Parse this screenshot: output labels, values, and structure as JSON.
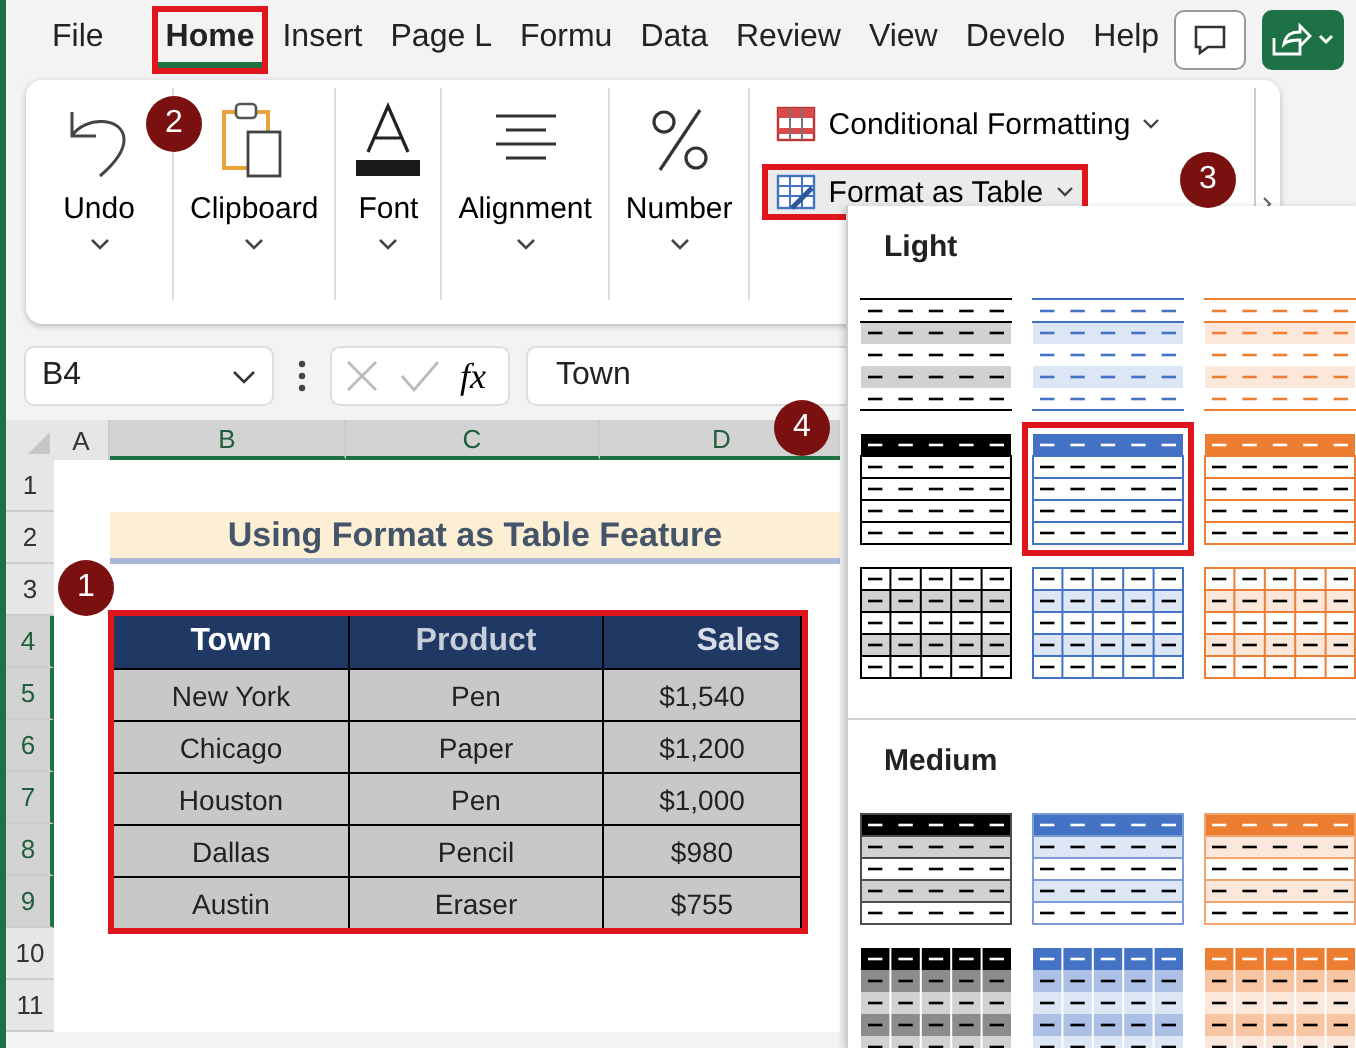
{
  "ribbon_tabs": [
    {
      "label": "File",
      "selected": false,
      "highlighted": false
    },
    {
      "label": "Home",
      "selected": true,
      "highlighted": true
    },
    {
      "label": "Insert",
      "selected": false,
      "highlighted": false
    },
    {
      "label": "Page L",
      "selected": false,
      "highlighted": false
    },
    {
      "label": "Formu",
      "selected": false,
      "highlighted": false
    },
    {
      "label": "Data",
      "selected": false,
      "highlighted": false
    },
    {
      "label": "Review",
      "selected": false,
      "highlighted": false
    },
    {
      "label": "View",
      "selected": false,
      "highlighted": false
    },
    {
      "label": "Develo",
      "selected": false,
      "highlighted": false
    },
    {
      "label": "Help",
      "selected": false,
      "highlighted": false
    }
  ],
  "ribbon_groups": [
    {
      "label": "Undo",
      "kind": "undo"
    },
    {
      "label": "Clipboard",
      "kind": "clipboard"
    },
    {
      "label": "Font",
      "kind": "font"
    },
    {
      "label": "Alignment",
      "kind": "alignment"
    },
    {
      "label": "Number",
      "kind": "number"
    }
  ],
  "styles_buttons": [
    {
      "label": "Conditional Formatting",
      "kind": "conditional",
      "highlighted": false
    },
    {
      "label": "Format as Table",
      "kind": "table",
      "highlighted": true
    }
  ],
  "formula_bar": {
    "name_box": "B4",
    "function_label": "fx",
    "value": "Town"
  },
  "sheet": {
    "columns": [
      {
        "label": "A",
        "selected": false
      },
      {
        "label": "B",
        "selected": true
      },
      {
        "label": "C",
        "selected": true
      },
      {
        "label": "D",
        "selected": true
      }
    ],
    "rows": [
      {
        "label": "1",
        "selected": false
      },
      {
        "label": "2",
        "selected": false
      },
      {
        "label": "3",
        "selected": false
      },
      {
        "label": "4",
        "selected": true
      },
      {
        "label": "5",
        "selected": true
      },
      {
        "label": "6",
        "selected": true
      },
      {
        "label": "7",
        "selected": true
      },
      {
        "label": "8",
        "selected": true
      },
      {
        "label": "9",
        "selected": true
      },
      {
        "label": "10",
        "selected": false
      },
      {
        "label": "11",
        "selected": false
      }
    ],
    "title": "Using Format as Table Feature",
    "table": {
      "highlighted": true,
      "columns": [
        "Town",
        "Product",
        "Sales"
      ],
      "rows": [
        [
          "New York",
          "Pen",
          "$1,540"
        ],
        [
          "Chicago",
          "Paper",
          "$1,200"
        ],
        [
          "Houston",
          "Pen",
          "$1,000"
        ],
        [
          "Dallas",
          "Pencil",
          "$980"
        ],
        [
          "Austin",
          "Eraser",
          "$755"
        ]
      ]
    }
  },
  "gallery": {
    "sections": [
      {
        "title": "Light",
        "styles": [
          {
            "kind": "banded",
            "color": "#000000",
            "selected": false
          },
          {
            "kind": "banded",
            "color": "#4472c4",
            "selected": false
          },
          {
            "kind": "banded",
            "color": "#ed7d31",
            "selected": false
          },
          {
            "kind": "header",
            "color": "#000000",
            "selected": false
          },
          {
            "kind": "header",
            "color": "#4472c4",
            "selected": true
          },
          {
            "kind": "header",
            "color": "#ed7d31",
            "selected": false
          },
          {
            "kind": "grid",
            "color": "#000000",
            "selected": false
          },
          {
            "kind": "grid",
            "color": "#4472c4",
            "selected": false
          },
          {
            "kind": "grid",
            "color": "#ed7d31",
            "selected": false
          }
        ]
      },
      {
        "title": "Medium",
        "styles": [
          {
            "kind": "medium",
            "color": "#000000",
            "selected": false
          },
          {
            "kind": "medium",
            "color": "#4472c4",
            "selected": false
          },
          {
            "kind": "medium",
            "color": "#ed7d31",
            "selected": false
          },
          {
            "kind": "medium-grid",
            "color": "#000000",
            "selected": false
          },
          {
            "kind": "medium-grid",
            "color": "#4472c4",
            "selected": false
          },
          {
            "kind": "medium-grid",
            "color": "#ed7d31",
            "selected": false
          }
        ]
      }
    ]
  },
  "callouts": [
    "1",
    "2",
    "3",
    "4"
  ]
}
